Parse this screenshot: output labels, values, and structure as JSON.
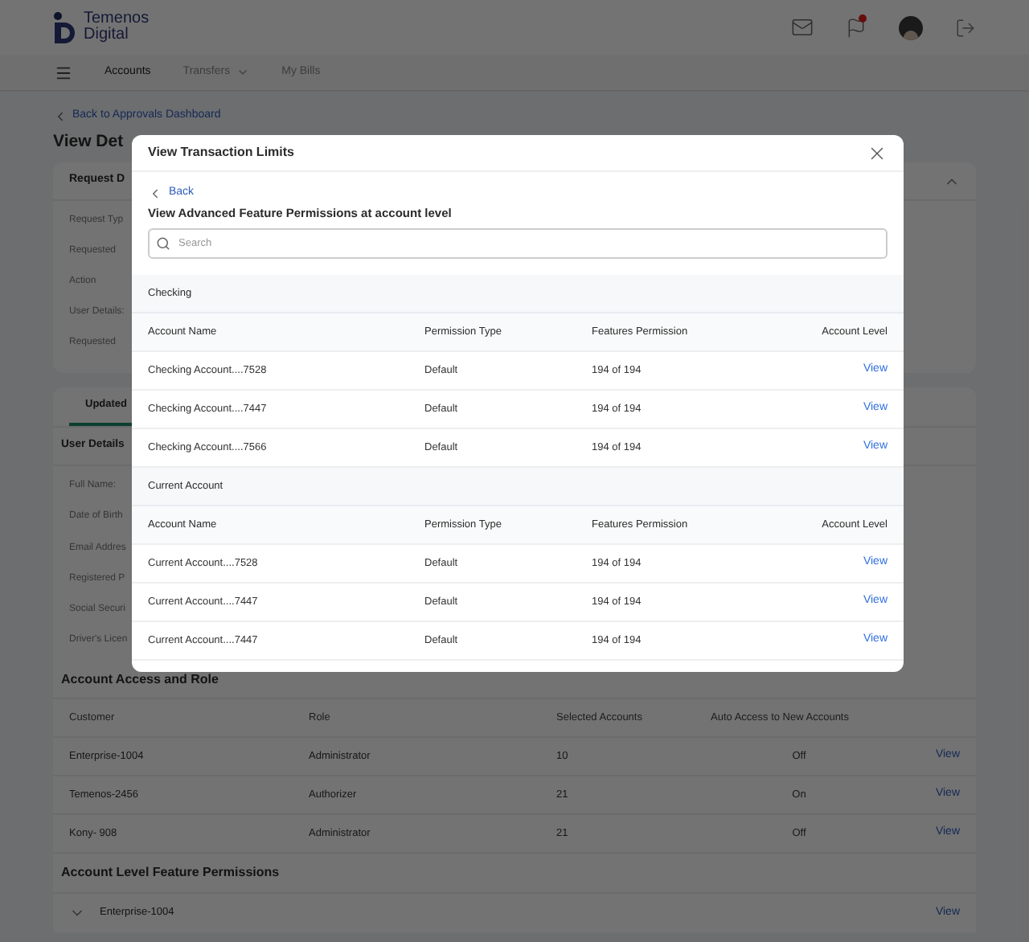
{
  "header": {
    "brand": [
      "Temenos",
      "Digital"
    ],
    "has_notification": true
  },
  "nav": [
    {
      "label": "Accounts",
      "selected": true,
      "has_menu": false
    },
    {
      "label": "Transfers",
      "selected": false,
      "has_menu": true
    },
    {
      "label": "My Bills",
      "selected": false,
      "has_menu": false
    }
  ],
  "back_link": "Back to Approvals Dashboard",
  "page_title": "View Det",
  "request_card": {
    "title": "Request D",
    "expanded": true,
    "rows": [
      "Request Typ",
      "Requested",
      "Action",
      "User Details:",
      "Requested"
    ]
  },
  "details_card": {
    "tabs": [
      {
        "label": "Updated",
        "selected": true
      }
    ],
    "title": "User Details",
    "rows": [
      "Full Name:",
      "Date of Birth",
      "Email Addres",
      "Registered P",
      "Social Securi",
      "Driver's Licen"
    ]
  },
  "access_table": {
    "title": "Account Access and Role",
    "columns": [
      "Customer",
      "Role",
      "Selected Accounts",
      "Auto Access to New Accounts"
    ],
    "rows": [
      {
        "cells": [
          "Enterprise-1004",
          "Administrator",
          "10",
          "Off"
        ],
        "action": "View"
      },
      {
        "cells": [
          "Temenos-2456",
          "Authorizer",
          "21",
          "On"
        ],
        "action": "View"
      },
      {
        "cells": [
          "Kony- 908",
          "Administrator",
          "21",
          "Off"
        ],
        "action": "View"
      }
    ]
  },
  "feature_permissions": {
    "title": "Account Level Feature Permissions",
    "rows": [
      {
        "label": "Enterprise-1004",
        "expanded": false,
        "action": "View"
      }
    ]
  },
  "modal": {
    "title": "View Transaction Limits",
    "back": "Back",
    "subtitle": "View Advanced Feature Permissions at account level",
    "search": {
      "placeholder": "Search"
    },
    "groups": [
      {
        "name": "Checking",
        "columns": [
          "Account Name",
          "Permission Type",
          "Features Permission",
          "Account Level"
        ],
        "rows": [
          {
            "cells": [
              "Checking Account....7528",
              "Default",
              "194 of 194"
            ],
            "action": "View"
          },
          {
            "cells": [
              "Checking Account....7447",
              "Default",
              "194 of 194"
            ],
            "action": "View"
          },
          {
            "cells": [
              "Checking Account....7566",
              "Default",
              "194 of 194"
            ],
            "action": "View"
          }
        ]
      },
      {
        "name": "Current Account",
        "columns": [
          "Account Name",
          "Permission Type",
          "Features Permission",
          "Account Level"
        ],
        "rows": [
          {
            "cells": [
              "Current Account....7528",
              "Default",
              "194 of 194"
            ],
            "action": "View"
          },
          {
            "cells": [
              "Current Account....7447",
              "Default",
              "194 of 194"
            ],
            "action": "View"
          },
          {
            "cells": [
              "Current Account....7447",
              "Default",
              "194 of 194"
            ],
            "action": "View"
          }
        ]
      }
    ]
  }
}
